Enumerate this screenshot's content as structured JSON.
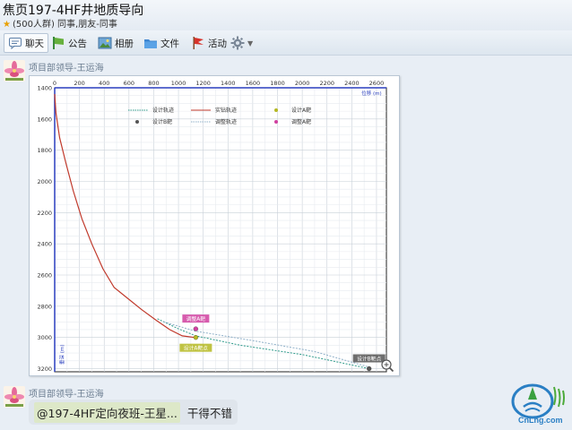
{
  "header": {
    "title": "焦页197-4HF井地质导向",
    "subtitle": "(500人群) 同事,朋友-同事"
  },
  "toolbar": {
    "items": [
      {
        "label": "聊天",
        "icon": "chat-icon"
      },
      {
        "label": "公告",
        "icon": "announcement-icon"
      },
      {
        "label": "相册",
        "icon": "album-icon"
      },
      {
        "label": "文件",
        "icon": "folder-icon"
      },
      {
        "label": "活动",
        "icon": "flag-icon"
      }
    ],
    "settings_icon": "gear-icon"
  },
  "messages": [
    {
      "sender": "项目部领导-王运海",
      "type": "image"
    },
    {
      "sender": "项目部领导-王运海",
      "mention": "@197-4HF定向夜班-王星...",
      "text": "干得不错"
    }
  ],
  "chart_data": {
    "type": "line",
    "x_ticks": [
      "0",
      "200",
      "400",
      "600",
      "800",
      "1000",
      "1200",
      "1400",
      "1600",
      "1800",
      "2000",
      "2200",
      "2400",
      "2600"
    ],
    "y_ticks": [
      "1400",
      "1600",
      "1800",
      "2000",
      "2200",
      "2400",
      "2600",
      "2800",
      "3000",
      "3200"
    ],
    "x_range": [
      0,
      2680
    ],
    "y_range": [
      1400,
      3220
    ],
    "x_axis_label": "位移 (m)",
    "y_axis_label": "垂深 (m)",
    "legend": [
      {
        "label": "设计轨迹",
        "style": "dotted",
        "color": "#2e9a8a"
      },
      {
        "label": "实钻轨迹",
        "style": "solid",
        "color": "#c0392b"
      },
      {
        "label": "设计A靶",
        "style": "marker",
        "color": "#b5b822"
      },
      {
        "label": "设计B靶",
        "style": "marker",
        "color": "#555555"
      },
      {
        "label": "调整轨迹",
        "style": "dotted",
        "color": "#8fb0c8"
      },
      {
        "label": "调整A靶",
        "style": "marker",
        "color": "#d040a0"
      }
    ],
    "series": [
      {
        "name": "实钻轨迹",
        "color": "#c0392b",
        "points": [
          [
            0,
            1440
          ],
          [
            10,
            1560
          ],
          [
            40,
            1720
          ],
          [
            90,
            1880
          ],
          [
            150,
            2060
          ],
          [
            220,
            2240
          ],
          [
            300,
            2400
          ],
          [
            390,
            2560
          ],
          [
            480,
            2680
          ],
          [
            590,
            2750
          ],
          [
            700,
            2820
          ],
          [
            820,
            2890
          ],
          [
            930,
            2950
          ],
          [
            1030,
            2990
          ],
          [
            1130,
            3000
          ]
        ]
      },
      {
        "name": "设计轨迹",
        "color": "#2e9a8a",
        "points": [
          [
            830,
            2880
          ],
          [
            1000,
            2945
          ],
          [
            1140,
            2990
          ],
          [
            1500,
            3050
          ],
          [
            2000,
            3110
          ],
          [
            2300,
            3160
          ],
          [
            2540,
            3200
          ]
        ]
      },
      {
        "name": "调整轨迹",
        "color": "#8fb0c8",
        "points": [
          [
            880,
            2900
          ],
          [
            1140,
            2960
          ],
          [
            1600,
            3020
          ],
          [
            2100,
            3090
          ],
          [
            2540,
            3190
          ]
        ]
      }
    ],
    "targets": [
      {
        "name": "调整A靶",
        "x": 1140,
        "y": 2945,
        "color": "#d040a0",
        "label": "调整A靶",
        "label_pos": "above"
      },
      {
        "name": "设计A靶",
        "x": 1140,
        "y": 3000,
        "color": "#b5b822",
        "label": "设计A靶点",
        "label_pos": "below"
      },
      {
        "name": "设计B靶",
        "x": 2540,
        "y": 3200,
        "color": "#555555",
        "label": "设计B靶点",
        "label_pos": "above"
      }
    ],
    "zoom_icon": "magnifier-plus-icon"
  },
  "watermark": {
    "text": "CnLng.com"
  }
}
